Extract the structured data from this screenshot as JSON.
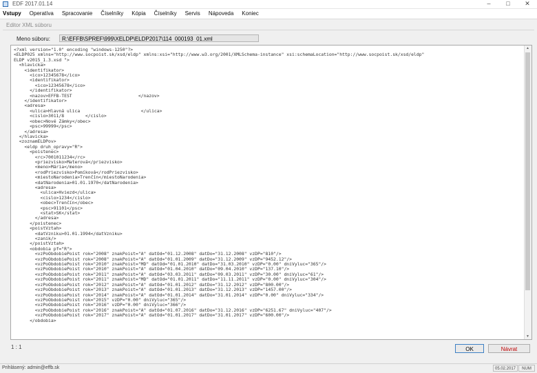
{
  "window": {
    "title": "EDF 2017.01.14",
    "controls": {
      "minimize": "–",
      "maximize": "□",
      "close": "✕"
    }
  },
  "menu": [
    "Vstupy",
    "Operatíva",
    "Spracovanie",
    "Číselníky",
    "Kópia",
    "Číselníky",
    "Servis",
    "Nápoveda",
    "Koniec"
  ],
  "editor_title": "Editor XML súboru",
  "file": {
    "label": "Meno súboru:",
    "path": "R:\\EFFB\\SPREF\\999\\XELDP\\ELDP2017\\114_000193_01.xml"
  },
  "xml_text": "<?xml version=\"1.0\" encoding \"windows-1250\"?>\n<ELDP025 xmlns=\"http://www.socpoist.sk/xsd/eldp\" xmlns:xsi=\"http://www.w3.org/2001/XMLSchema-instance\" xsi:schemaLocation=\"http://www.socpoist.sk/xsd/eldp\"\nELDP v2015_1.3.xsd \">\n  <hlavicka>\n    <identifikator>\n      <ico>12345678</ico>\n      <identifikator>\n        <ico>12345678</ico>\n      </identifikator>\n      <nazov>EFFB-TEST                         </nazov>\n    </identifikator>\n    <adresa>\n      <ulica>Hlavná ulica                       </ulica>\n      <cislo>3011/8        </cislo>\n      <obec>Nové Zámky</obec>\n      <psc>99999</psc>\n    </adresa>\n  </hlavicka>\n  <zoznamELDPov>\n    <eldp druh_opravy=\"R\">\n      <poistenec>\n        <rc>7001011234</rc>\n        <priezvisko>Materová</priezvisko>\n        <meno>Mária</meno>\n        <rodPriezvisko>Pomíková</rodPriezvisko>\n        <miestoNarodenia>Trenčín</miestoNarodenia>\n        <datNarodenia>01.01.1970</datNarodenia>\n        <adresa>\n          <ulica>Hviezd</ulica>\n          <cislo>1234</cislo>\n          <obec>Trenčín</obec>\n          <psc>91101</psc>\n          <stat>SK</stat>\n        </adresa>\n      </poistenec>\n      <poistVztah>\n        <datVzniku>01.01.1994</datVzniku>\n        <zanik/>\n      </poistVztah>\n      <obdobia pf=\"R\">\n        <vzPoObdobiePoist rok=\"2008\" znakPoist=\"A\" datOd=\"01.12.2008\" datDo=\"31.12.2008\" vzDP=\"810\"/>\n        <vzPoObdobiePoist rok=\"2008\" znakPoist=\"A\" datOd=\"01.01.2009\" datDo=\"31.12.2009\" vzDP=\"9452.12\"/>\n        <vzPoObdobiePoist rok=\"2010\" znakPoist=\"MD\" datOd=\"01.01.2010\" datDo=\"31.03.2010\" vzDP=\"0.00\" dniVyluc=\"365\"/>\n        <vzPoObdobiePoist rok=\"2010\" znakPoist=\"A\" datOd=\"01.04.2010\" datDo=\"09.04.2010\" vzDP=\"137.10\"/>\n        <vzPoObdobiePoist rok=\"2011\" znakPoist=\"A\" datOd=\"03.03.2011\" datDo=\"09.03.2011\" vzDP=\"30.00\" dniVyluc=\"61\"/>\n        <vzPoObdobiePoist rok=\"2011\" znakPoist=\"MD\" datOd=\"01.01.2011\" datDo=\"11.11.2011\" vzDP=\"0.00\" dniVyluc=\"304\"/>\n        <vzPoObdobiePoist rok=\"2012\" znakPoist=\"A\" datOd=\"01.01.2012\" datDo=\"31.12.2012\" vzDP=\"800.00\"/>\n        <vzPoObdobiePoist rok=\"2013\" znakPoist=\"A\" datOd=\"01.01.2013\" datDo=\"31.12.2013\" vzDP=\"1457.00\"/>\n        <vzPoObdobiePoist rok=\"2014\" znakPoist=\"A\" datOd=\"01.01.2014\" datDo=\"31.01.2014\" vzDP=\"0.00\" dniVyluc=\"334\"/>\n        <vzPoObdobiePoist rok=\"2015\" vzDP=\"0.00\" dniVyluc=\"365\"/>\n        <vzPoObdobiePoist rok=\"2016\" vzDP=\"0.00\" dniVyluc=\"366\"/>\n        <vzPoObdobiePoist rok=\"2016\" znakPoist=\"A\" datOd=\"01.07.2016\" datDo=\"31.12.2016\" vzDP=\"6251.67\" dniVyluc=\"407\"/>\n        <vzPoObdobiePoist rok=\"2017\" znakPoist=\"A\" datOd=\"01.01.2017\" datDo=\"31.01.2017\" vzDP=\"600.00\"/>\n      </obdobia>",
  "status_line": "1 : 1",
  "buttons": {
    "ok": "OK",
    "cancel": "Návrat"
  },
  "statusbar": {
    "left": "Prihlásený: admin@effb.sk",
    "cells": [
      "05.02.2017",
      "NUM"
    ]
  },
  "colors": {
    "ok_border": "#3c7fc4",
    "cancel_text": "#c00000"
  }
}
